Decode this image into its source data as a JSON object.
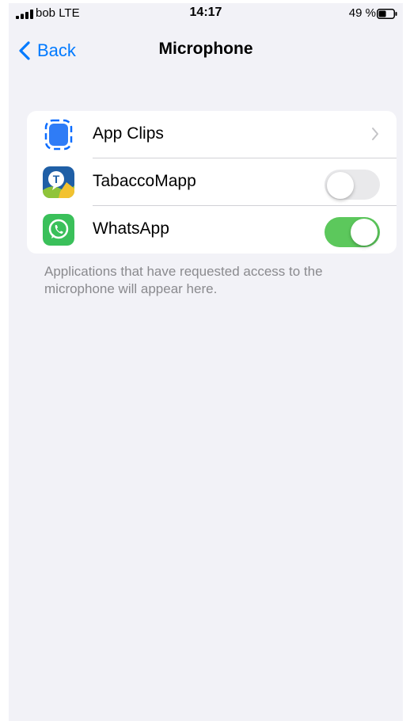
{
  "status_bar": {
    "carrier": "bob  LTE",
    "time": "14:17",
    "battery_percent": "49 %",
    "battery_level": 0.49,
    "signal_icon": "signal-bars-icon",
    "battery_icon": "battery-icon"
  },
  "nav": {
    "back_label": "Back",
    "title": "Microphone",
    "accent_color": "#007aff"
  },
  "apps": [
    {
      "name": "App Clips",
      "icon": "app-clips-icon",
      "control": "chevron"
    },
    {
      "name": "TabaccoMapp",
      "icon": "tabaccomapp-icon",
      "control": "toggle",
      "enabled": false
    },
    {
      "name": "WhatsApp",
      "icon": "whatsapp-icon",
      "control": "toggle",
      "enabled": true
    }
  ],
  "footer_note": "Applications that have requested access to the microphone will appear here.",
  "colors": {
    "background": "#f2f2f7",
    "toggle_on": "#5cc85c",
    "toggle_off": "#e9e9eb"
  }
}
